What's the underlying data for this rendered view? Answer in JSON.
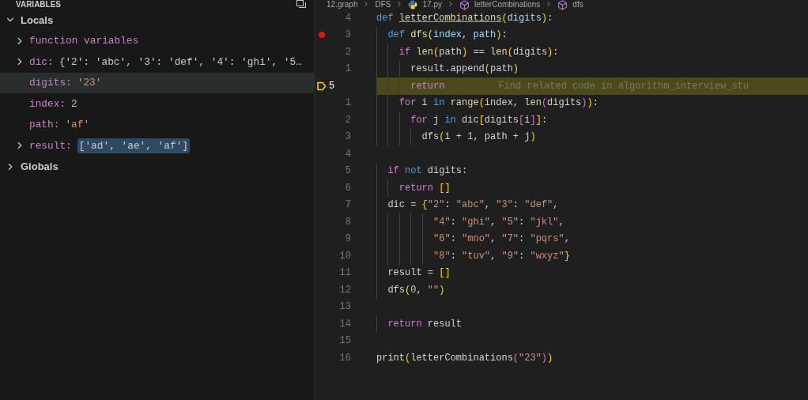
{
  "variables_panel": {
    "title": "VARIABLES",
    "scopes": [
      {
        "label": "Locals",
        "expanded": true,
        "children": [
          {
            "name": "function variables",
            "expanded": false,
            "selected": false
          },
          {
            "name": "dic:",
            "value": "{'2': 'abc', '3': 'def', '4': 'ghi', '5…",
            "kind": "object",
            "expanded": false,
            "selected": false,
            "changed": false
          },
          {
            "name": "digits:",
            "value": "'23'",
            "kind": "string",
            "selected": true,
            "changed": false
          },
          {
            "name": "index:",
            "value": "2",
            "kind": "number",
            "selected": false,
            "changed": false
          },
          {
            "name": "path:",
            "value": "'af'",
            "kind": "string",
            "selected": false,
            "changed": false
          },
          {
            "name": "result:",
            "value": "['ad', 'ae', 'af']",
            "kind": "object",
            "expanded": false,
            "selected": false,
            "changed": true
          }
        ]
      },
      {
        "label": "Globals",
        "expanded": false
      }
    ]
  },
  "breadcrumb": [
    {
      "label": "12.graph",
      "kind": "folder"
    },
    {
      "label": "DFS",
      "kind": "folder"
    },
    {
      "label": "17.py",
      "kind": "python-file"
    },
    {
      "label": "letterCombinations",
      "kind": "symbol"
    },
    {
      "label": "dfs",
      "kind": "symbol"
    }
  ],
  "editor": {
    "lines": [
      {
        "number": "4",
        "breakpoint": false,
        "current": false,
        "tokens": [
          {
            "kind": "kw",
            "t": "def "
          },
          {
            "kind": "link",
            "t": "letterCombinations"
          },
          {
            "kind": "b1",
            "t": "("
          },
          {
            "kind": "param",
            "t": "digits"
          },
          {
            "kind": "b1",
            "t": ")"
          },
          {
            "kind": "p",
            "t": ":"
          }
        ]
      },
      {
        "number": "3",
        "breakpoint": true,
        "current": false,
        "tokens": [
          {
            "kind": "kw",
            "t": "  def "
          },
          {
            "kind": "fn",
            "t": "dfs"
          },
          {
            "kind": "b1",
            "t": "("
          },
          {
            "kind": "param",
            "t": "index"
          },
          {
            "kind": "p",
            "t": ", "
          },
          {
            "kind": "param",
            "t": "path"
          },
          {
            "kind": "b1",
            "t": ")"
          },
          {
            "kind": "p",
            "t": ":"
          }
        ]
      },
      {
        "number": "2",
        "breakpoint": false,
        "current": false,
        "tokens": [
          {
            "kind": "ctl",
            "t": "    if "
          },
          {
            "kind": "fn",
            "t": "len"
          },
          {
            "kind": "b1",
            "t": "("
          },
          {
            "kind": "p",
            "t": "path"
          },
          {
            "kind": "b1",
            "t": ")"
          },
          {
            "kind": "p",
            "t": " == "
          },
          {
            "kind": "fn",
            "t": "len"
          },
          {
            "kind": "b1",
            "t": "("
          },
          {
            "kind": "p",
            "t": "digits"
          },
          {
            "kind": "b1",
            "t": ")"
          },
          {
            "kind": "p",
            "t": ":"
          }
        ]
      },
      {
        "number": "1",
        "breakpoint": false,
        "current": false,
        "tokens": [
          {
            "kind": "p",
            "t": "      result.append"
          },
          {
            "kind": "b1",
            "t": "("
          },
          {
            "kind": "p",
            "t": "path"
          },
          {
            "kind": "b1",
            "t": ")"
          }
        ]
      },
      {
        "number": "5",
        "breakpoint": false,
        "current": true,
        "hint": "Find related code in algorithm_interview_stu",
        "tokens": [
          {
            "kind": "ctl",
            "t": "      return"
          }
        ]
      },
      {
        "number": "1",
        "breakpoint": false,
        "current": false,
        "tokens": [
          {
            "kind": "ctl",
            "t": "    for "
          },
          {
            "kind": "p",
            "t": "i "
          },
          {
            "kind": "kw",
            "t": "in "
          },
          {
            "kind": "fn",
            "t": "range"
          },
          {
            "kind": "b1",
            "t": "("
          },
          {
            "kind": "p",
            "t": "index, "
          },
          {
            "kind": "fn",
            "t": "len"
          },
          {
            "kind": "b2",
            "t": "("
          },
          {
            "kind": "p",
            "t": "digits"
          },
          {
            "kind": "b2",
            "t": ")"
          },
          {
            "kind": "b1",
            "t": ")"
          },
          {
            "kind": "p",
            "t": ":"
          }
        ]
      },
      {
        "number": "2",
        "breakpoint": false,
        "current": false,
        "tokens": [
          {
            "kind": "ctl",
            "t": "      for "
          },
          {
            "kind": "p",
            "t": "j "
          },
          {
            "kind": "kw",
            "t": "in "
          },
          {
            "kind": "p",
            "t": "dic"
          },
          {
            "kind": "b1",
            "t": "["
          },
          {
            "kind": "p",
            "t": "digits"
          },
          {
            "kind": "b2",
            "t": "["
          },
          {
            "kind": "p",
            "t": "i"
          },
          {
            "kind": "b2",
            "t": "]"
          },
          {
            "kind": "b1",
            "t": "]"
          },
          {
            "kind": "p",
            "t": ":"
          }
        ]
      },
      {
        "number": "3",
        "breakpoint": false,
        "current": false,
        "tokens": [
          {
            "kind": "p",
            "t": "        dfs"
          },
          {
            "kind": "b1",
            "t": "("
          },
          {
            "kind": "p",
            "t": "i + "
          },
          {
            "kind": "num",
            "t": "1"
          },
          {
            "kind": "p",
            "t": ", path + j"
          },
          {
            "kind": "b1",
            "t": ")"
          }
        ]
      },
      {
        "number": "4",
        "breakpoint": false,
        "current": false
      },
      {
        "number": "5",
        "breakpoint": false,
        "current": false,
        "tokens": [
          {
            "kind": "ctl",
            "t": "  if "
          },
          {
            "kind": "kw",
            "t": "not "
          },
          {
            "kind": "p",
            "t": "digits:"
          }
        ]
      },
      {
        "number": "6",
        "breakpoint": false,
        "current": false,
        "tokens": [
          {
            "kind": "ctl",
            "t": "    return "
          },
          {
            "kind": "b1",
            "t": "[]"
          }
        ]
      },
      {
        "number": "7",
        "breakpoint": false,
        "current": false,
        "tokens": [
          {
            "kind": "p",
            "t": "  dic = "
          },
          {
            "kind": "b1",
            "t": "{"
          },
          {
            "kind": "str",
            "t": "\"2\""
          },
          {
            "kind": "p",
            "t": ": "
          },
          {
            "kind": "str",
            "t": "\"abc\""
          },
          {
            "kind": "p",
            "t": ", "
          },
          {
            "kind": "str",
            "t": "\"3\""
          },
          {
            "kind": "p",
            "t": ": "
          },
          {
            "kind": "str",
            "t": "\"def\""
          },
          {
            "kind": "p",
            "t": ","
          }
        ]
      },
      {
        "number": "8",
        "breakpoint": false,
        "current": false,
        "tokens": [
          {
            "kind": "str",
            "t": "          \"4\""
          },
          {
            "kind": "p",
            "t": ": "
          },
          {
            "kind": "str",
            "t": "\"ghi\""
          },
          {
            "kind": "p",
            "t": ", "
          },
          {
            "kind": "str",
            "t": "\"5\""
          },
          {
            "kind": "p",
            "t": ": "
          },
          {
            "kind": "str",
            "t": "\"jkl\""
          },
          {
            "kind": "p",
            "t": ","
          }
        ]
      },
      {
        "number": "9",
        "breakpoint": false,
        "current": false,
        "tokens": [
          {
            "kind": "str",
            "t": "          \"6\""
          },
          {
            "kind": "p",
            "t": ": "
          },
          {
            "kind": "str",
            "t": "\"mno\""
          },
          {
            "kind": "p",
            "t": ", "
          },
          {
            "kind": "str",
            "t": "\"7\""
          },
          {
            "kind": "p",
            "t": ": "
          },
          {
            "kind": "str",
            "t": "\"pqrs\""
          },
          {
            "kind": "p",
            "t": ","
          }
        ]
      },
      {
        "number": "10",
        "breakpoint": false,
        "current": false,
        "tokens": [
          {
            "kind": "str",
            "t": "          \"8\""
          },
          {
            "kind": "p",
            "t": ": "
          },
          {
            "kind": "str",
            "t": "\"tuv\""
          },
          {
            "kind": "p",
            "t": ", "
          },
          {
            "kind": "str",
            "t": "\"9\""
          },
          {
            "kind": "p",
            "t": ": "
          },
          {
            "kind": "str",
            "t": "\"wxyz\""
          },
          {
            "kind": "b1",
            "t": "}"
          }
        ]
      },
      {
        "number": "11",
        "breakpoint": false,
        "current": false,
        "tokens": [
          {
            "kind": "p",
            "t": "  result = "
          },
          {
            "kind": "b1",
            "t": "[]"
          }
        ]
      },
      {
        "number": "12",
        "breakpoint": false,
        "current": false,
        "tokens": [
          {
            "kind": "p",
            "t": "  dfs"
          },
          {
            "kind": "b1",
            "t": "("
          },
          {
            "kind": "num",
            "t": "0"
          },
          {
            "kind": "p",
            "t": ", "
          },
          {
            "kind": "str",
            "t": "\"\""
          },
          {
            "kind": "b1",
            "t": ")"
          }
        ]
      },
      {
        "number": "13",
        "breakpoint": false,
        "current": false
      },
      {
        "number": "14",
        "breakpoint": false,
        "current": false,
        "tokens": [
          {
            "kind": "ctl",
            "t": "  return "
          },
          {
            "kind": "p",
            "t": "result"
          }
        ]
      },
      {
        "number": "15",
        "breakpoint": false,
        "current": false
      },
      {
        "number": "16",
        "breakpoint": false,
        "current": false,
        "tokens": [
          {
            "kind": "fn",
            "t": "print"
          },
          {
            "kind": "b1",
            "t": "("
          },
          {
            "kind": "p",
            "t": "letterCombinations"
          },
          {
            "kind": "b2",
            "t": "("
          },
          {
            "kind": "str",
            "t": "\"23\""
          },
          {
            "kind": "b2",
            "t": ")"
          },
          {
            "kind": "b1",
            "t": ")"
          }
        ]
      }
    ]
  }
}
